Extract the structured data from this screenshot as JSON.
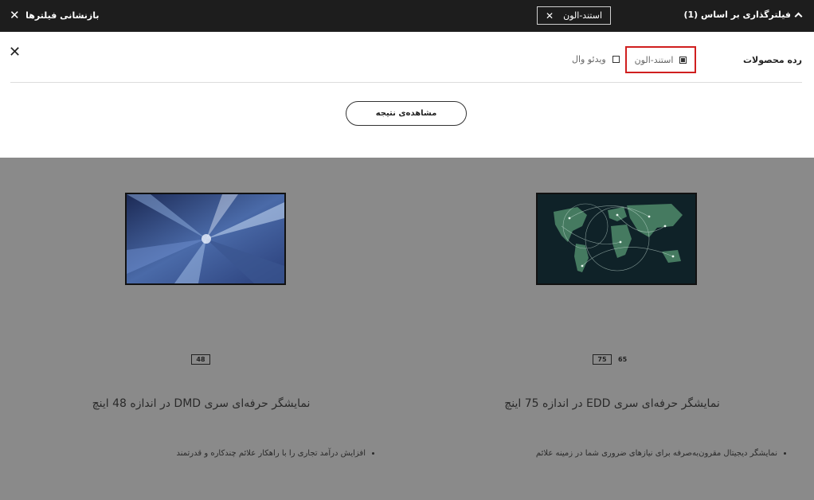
{
  "topbar": {
    "reset_label": "بازنشانی فیلترها",
    "chip_label": "استند-الون",
    "sort_label": "فیلترگذاری بر اساس (1)"
  },
  "filter_panel": {
    "category_label": "رده محصولات",
    "options": [
      {
        "label": "استند-الون",
        "checked": true
      },
      {
        "label": "ویدئو وال",
        "checked": false
      }
    ],
    "result_button": "مشاهده‌ی نتیجه"
  },
  "products": [
    {
      "title": "نمایشگر حرفه‌ای سری DMD در اندازه 48 اینچ",
      "sizes": [
        {
          "label": "48",
          "selected": true
        }
      ],
      "feature": "افزایش درآمد تجاری را با راهکار علائم چندکاره و قدرتمند"
    },
    {
      "title": "نمایشگر حرفه‌ای سری EDD در اندازه 75 اینچ",
      "sizes": [
        {
          "label": "75",
          "selected": true
        },
        {
          "label": "65",
          "selected": false
        }
      ],
      "feature": "نمایشگر دیجیتال مقرون‌به‌صرفه برای نیازهای ضروری شما در زمینه علائم"
    }
  ],
  "colors": {
    "topbar_bg": "#1d1d1d",
    "overlay_bg": "#8a8a8a",
    "highlight_border": "#d01f1f"
  }
}
